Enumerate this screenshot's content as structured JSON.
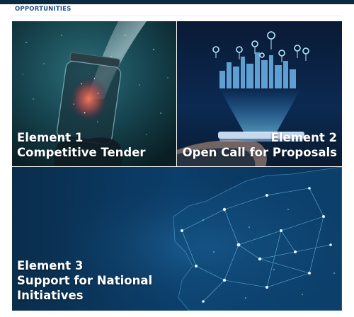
{
  "section": {
    "title": "OPPORTUNITIES"
  },
  "tiles": [
    {
      "line1": "Element 1",
      "line2": "Competitive Tender"
    },
    {
      "line1": "Element 2",
      "line2": "Open Call for Proposals"
    },
    {
      "line1": "Element 3",
      "line2": "Support for National",
      "line3": "Initiatives"
    }
  ],
  "colors": {
    "header_bar": "#0b2a3f",
    "label_blue": "#1d4e86",
    "tile_text": "#ffffff"
  },
  "images": {
    "tile1": "galaxy-in-jar-photo",
    "tile2": "smart-city-hologram-photo",
    "tile3": "europe-network-map-illustration"
  }
}
